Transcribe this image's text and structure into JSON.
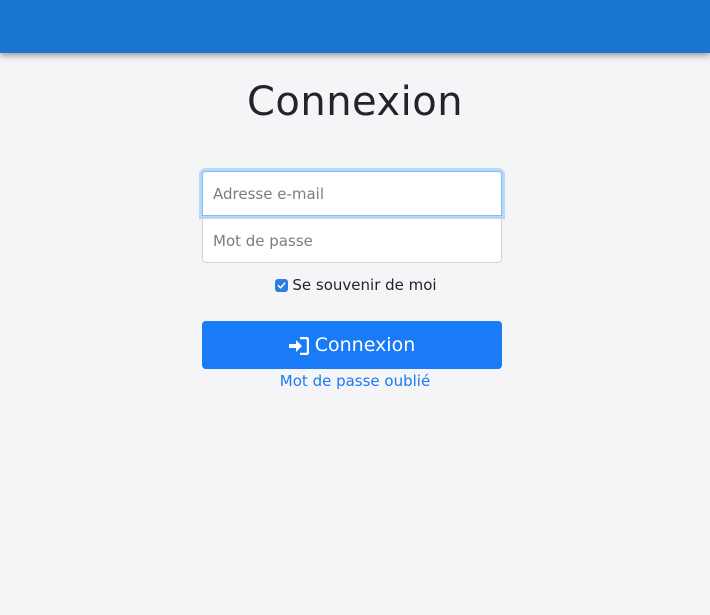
{
  "header": {
    "bar_color": "#1b76d2"
  },
  "login": {
    "title": "Connexion",
    "email": {
      "placeholder": "Adresse e-mail",
      "value": ""
    },
    "password": {
      "placeholder": "Mot de passe",
      "value": ""
    },
    "remember_me": {
      "label": "Se souvenir de moi",
      "checked": true
    },
    "submit": {
      "label": "Connexion",
      "icon": "sign-in-icon",
      "color": "#1a7bf6"
    },
    "forgot_password": {
      "label": "Mot de passe oublié"
    }
  }
}
